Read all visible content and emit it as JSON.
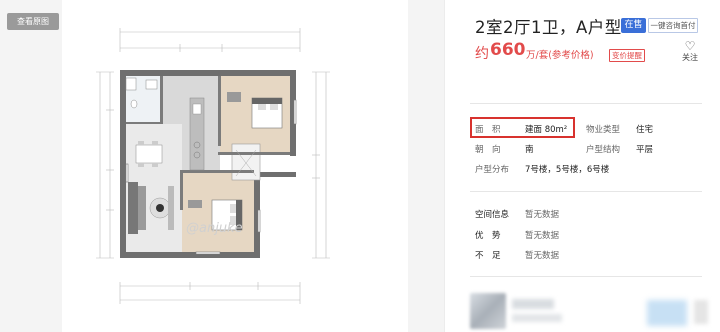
{
  "gallery": {
    "view_large_label": "查看原图",
    "watermark": "@anjuke"
  },
  "listing": {
    "title": "2室2厅1卫，A户型",
    "sale_status": "在售",
    "consult_button": "一键咨询首付",
    "price_prefix": "约",
    "price_value": "660",
    "price_unit": "万/套(参考价格)",
    "price_alert_button": "变价提醒",
    "follow_icon": "heart-outline-icon",
    "follow_label": "关注"
  },
  "attributes": {
    "area_label": "面　积",
    "area_value": "建面 80m²",
    "property_type_label": "物业类型",
    "property_type_value": "住宅",
    "orientation_label": "朝　向",
    "orientation_value": "南",
    "structure_label": "户型结构",
    "structure_value": "平层",
    "distribution_label": "户型分布",
    "distribution_value": "7号楼，5号楼，6号楼"
  },
  "extra": {
    "space_label": "空间信息",
    "space_value": "暂无数据",
    "advantage_label": "优　势",
    "advantage_value": "暂无数据",
    "shortcoming_label": "不　足",
    "shortcoming_value": "暂无数据"
  },
  "colors": {
    "price_red": "#e24b4b",
    "badge_blue": "#3a6fd8",
    "highlight_red": "#d8322e"
  }
}
